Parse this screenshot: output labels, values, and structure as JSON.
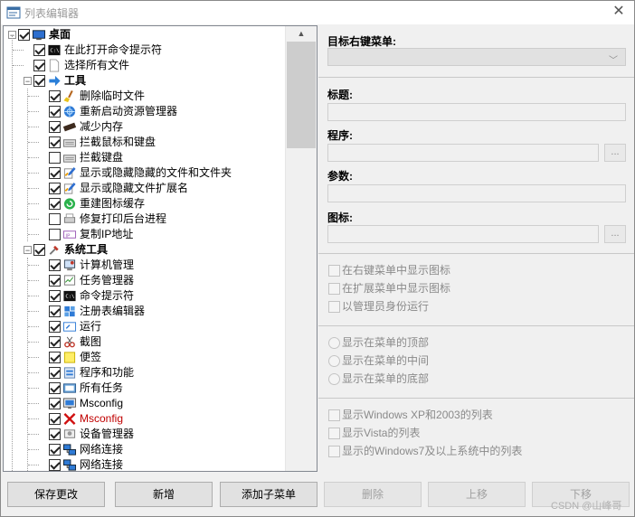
{
  "window": {
    "title": "列表编辑器",
    "close_glyph": "✕"
  },
  "tree": {
    "nodes": [
      {
        "label": "桌面",
        "bold": true,
        "checked": true,
        "expander": "−",
        "icon": "desktop-icon"
      },
      {
        "label": "在此打开命令提示符",
        "checked": true,
        "icon": "cmd-icon"
      },
      {
        "label": "选择所有文件",
        "checked": true,
        "icon": "file-icon"
      },
      {
        "label": "工具",
        "bold": true,
        "checked": true,
        "expander": "−",
        "icon": "arrow-icon"
      },
      {
        "label": "删除临时文件",
        "checked": true,
        "icon": "broom-icon"
      },
      {
        "label": "重新启动资源管理器",
        "checked": true,
        "icon": "globe-icon"
      },
      {
        "label": "减少内存",
        "checked": true,
        "icon": "memory-icon"
      },
      {
        "label": "拦截鼠标和键盘",
        "checked": true,
        "icon": "keyboard-icon"
      },
      {
        "label": "拦截键盘",
        "checked": false,
        "icon": "keyboard-icon"
      },
      {
        "label": "显示或隐藏隐藏的文件和文件夹",
        "checked": true,
        "icon": "pen-icon"
      },
      {
        "label": "显示或隐藏文件扩展名",
        "checked": true,
        "icon": "pen-icon"
      },
      {
        "label": "重建图标缓存",
        "checked": true,
        "icon": "refresh-icon"
      },
      {
        "label": "修复打印后台进程",
        "checked": false,
        "icon": "printer-icon"
      },
      {
        "label": "复制IP地址",
        "checked": false,
        "icon": "ip-icon"
      },
      {
        "label": "系统工具",
        "bold": true,
        "checked": true,
        "expander": "−",
        "icon": "tools-icon"
      },
      {
        "label": "计算机管理",
        "checked": true,
        "icon": "computer-management-icon"
      },
      {
        "label": "任务管理器",
        "checked": true,
        "icon": "task-manager-icon"
      },
      {
        "label": "命令提示符",
        "checked": true,
        "icon": "cmd-icon"
      },
      {
        "label": "注册表编辑器",
        "checked": true,
        "icon": "regedit-icon"
      },
      {
        "label": "运行",
        "checked": true,
        "icon": "run-icon"
      },
      {
        "label": "截图",
        "checked": true,
        "icon": "snip-icon"
      },
      {
        "label": "便签",
        "checked": true,
        "icon": "note-icon"
      },
      {
        "label": "程序和功能",
        "checked": true,
        "icon": "programs-icon"
      },
      {
        "label": "所有任务",
        "checked": true,
        "icon": "control-panel-icon"
      },
      {
        "label": "Msconfig",
        "checked": true,
        "icon": "msconfig-icon"
      },
      {
        "label": "Msconfig",
        "checked": true,
        "red": true,
        "icon": "red-x-icon"
      },
      {
        "label": "设备管理器",
        "checked": true,
        "icon": "device-manager-icon"
      },
      {
        "label": "网络连接",
        "checked": true,
        "icon": "network-icon"
      },
      {
        "label": "网络连接",
        "checked": true,
        "icon": "network-icon"
      }
    ]
  },
  "form": {
    "target_menu_label": "目标右键菜单:",
    "target_menu_value": "",
    "title_label": "标题:",
    "title_value": "",
    "program_label": "程序:",
    "program_value": "",
    "params_label": "参数:",
    "params_value": "",
    "icon_label": "图标:",
    "icon_value": "",
    "browse_label": "...",
    "options": [
      "在右键菜单中显示图标",
      "在扩展菜单中显示图标",
      "以管理员身份运行"
    ],
    "positions": [
      "显示在菜单的顶部",
      "显示在菜单的中间",
      "显示在菜单的底部"
    ],
    "os_lists": [
      "显示Windows XP和2003的列表",
      "显示Vista的列表",
      "显示的Windows7及以上系统中的列表"
    ]
  },
  "buttons": {
    "save": "保存更改",
    "add": "新增",
    "add_sub": "添加子菜单",
    "delete": "删除",
    "move_up": "上移",
    "move_down": "下移"
  },
  "watermark": "CSDN @山峰哥"
}
